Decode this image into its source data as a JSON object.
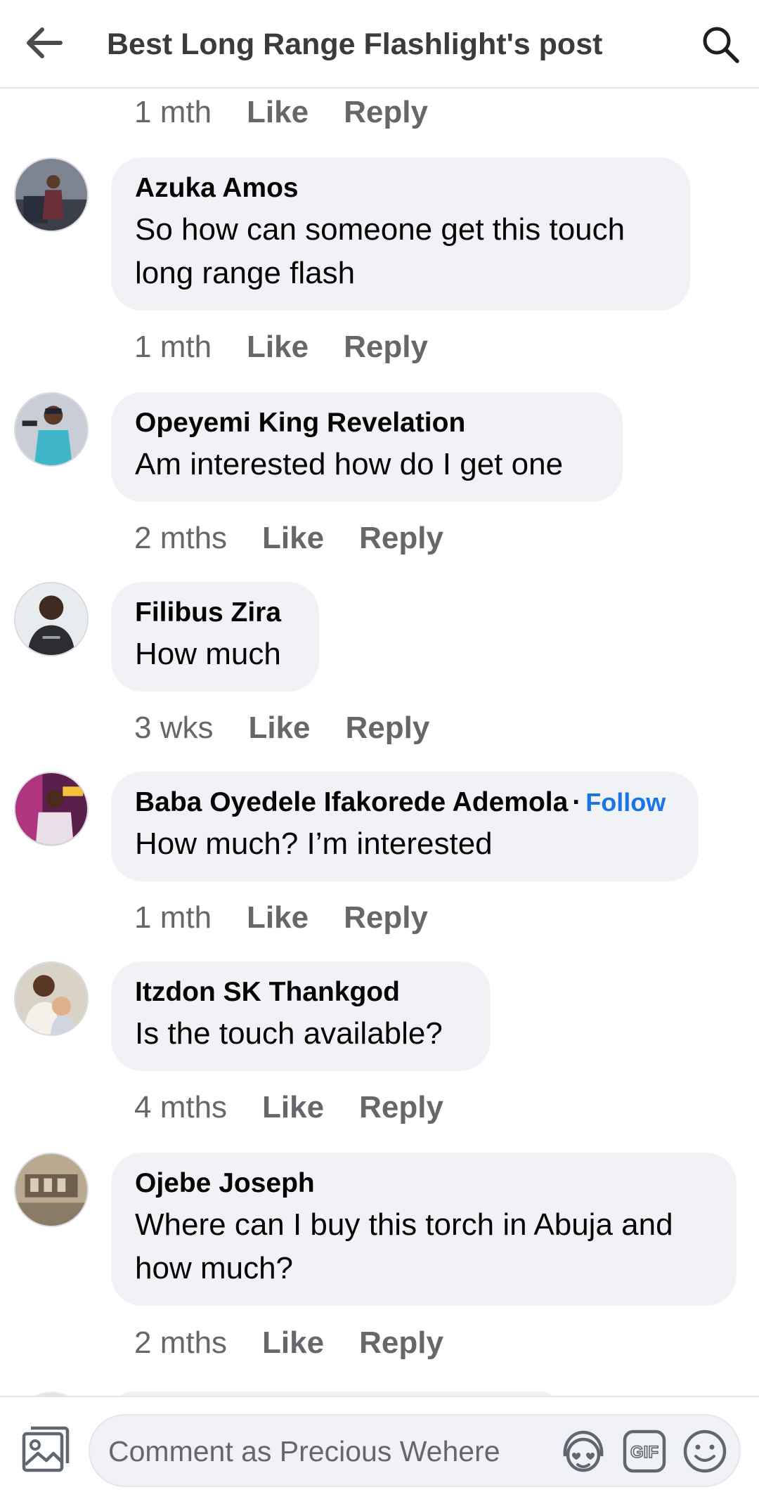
{
  "header": {
    "title": "Best Long Range Flashlight's post"
  },
  "top_meta": {
    "time": "1 mth",
    "like": "Like",
    "reply": "Reply"
  },
  "comments": [
    {
      "author": "Azuka Amos",
      "text": "So how can someone get this touch long range flash",
      "time": "1 mth",
      "like": "Like",
      "reply": "Reply"
    },
    {
      "author": "Opeyemi King Revelation",
      "text": "Am interested how do I get one",
      "time": "2 mths",
      "like": "Like",
      "reply": "Reply"
    },
    {
      "author": "Filibus Zira",
      "text": "How much",
      "time": "3 wks",
      "like": "Like",
      "reply": "Reply"
    },
    {
      "author": "Baba Oyedele Ifakorede Ademola",
      "separator": "·",
      "follow": "Follow",
      "text": "How much? I’m interested",
      "time": "1 mth",
      "like": "Like",
      "reply": "Reply"
    },
    {
      "author": "Itzdon SK Thankgod",
      "text": "Is the touch available?",
      "time": "4 mths",
      "like": "Like",
      "reply": "Reply"
    },
    {
      "author": "Ojebe Joseph",
      "text": "Where can I buy this torch in Abuja and how much?",
      "time": "2 mths",
      "like": "Like",
      "reply": "Reply"
    }
  ],
  "composer": {
    "placeholder": "Comment as Precious Wehere",
    "gif_label": "GIF"
  },
  "icons": [
    "back-arrow-icon",
    "search-icon",
    "photo-icon",
    "avatar-sticker-icon",
    "gif-icon",
    "emoji-icon"
  ],
  "colors": {
    "link_blue": "#1b74e4",
    "bubble_bg": "#f0f2f5",
    "meta_gray": "#65676b"
  }
}
